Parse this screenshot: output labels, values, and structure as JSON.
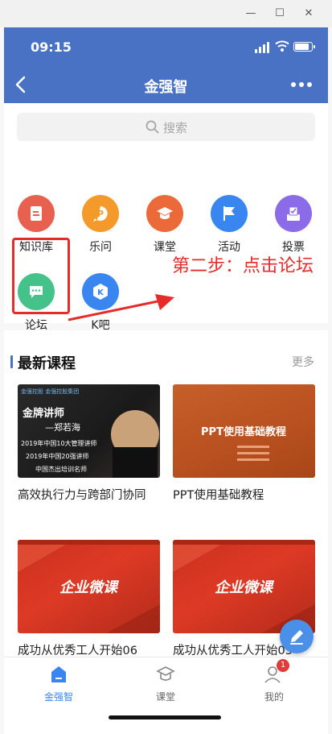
{
  "window": {
    "minimize": "—",
    "maximize": "☐",
    "close": "✕"
  },
  "status": {
    "time": "09:15",
    "battery_level": 0.9
  },
  "nav": {
    "title": "金强智"
  },
  "search": {
    "placeholder": "搜索"
  },
  "grid": [
    {
      "label": "知识库",
      "color": "#e8604e",
      "icon": "knowledge-base-icon"
    },
    {
      "label": "乐问",
      "color": "#f39a2b",
      "icon": "question-icon"
    },
    {
      "label": "课堂",
      "color": "#ec6a3a",
      "icon": "classroom-icon"
    },
    {
      "label": "活动",
      "color": "#3a86f0",
      "icon": "flag-icon"
    },
    {
      "label": "投票",
      "color": "#8c6be8",
      "icon": "vote-icon"
    },
    {
      "label": "论坛",
      "color": "#44c28a",
      "icon": "forum-icon"
    },
    {
      "label": "K吧",
      "color": "#3a86f0",
      "icon": "k-bar-icon"
    }
  ],
  "annotation": {
    "text": "第二步：点击论坛",
    "color": "#e62b2b"
  },
  "courses": {
    "title": "最新课程",
    "more": "更多",
    "items": [
      {
        "title": "高效执行力与跨部门协同",
        "thumb_lines": [
          "金强控股 金强控股集团",
          "金牌讲师",
          "—郑若海",
          "2019年中国10大管理讲师",
          "2019年中国20强讲师",
          "中国杰出培训名师"
        ]
      },
      {
        "title": "PPT使用基础教程",
        "thumb_lines": [
          "PPT使用基础教程"
        ]
      },
      {
        "title": "成功从优秀工人开始06",
        "thumb_lines": [
          "企业微课"
        ]
      },
      {
        "title": "成功从优秀工人开始05",
        "thumb_lines": [
          "企业微课"
        ]
      }
    ]
  },
  "tabs": [
    {
      "label": "金强智",
      "active": true,
      "icon": "home-icon"
    },
    {
      "label": "课堂",
      "active": false,
      "icon": "classroom-tab-icon"
    },
    {
      "label": "我的",
      "active": false,
      "icon": "profile-icon",
      "badge": "1"
    }
  ],
  "colors": {
    "brand": "#4a72c4",
    "active_tab": "#3a86f0"
  }
}
